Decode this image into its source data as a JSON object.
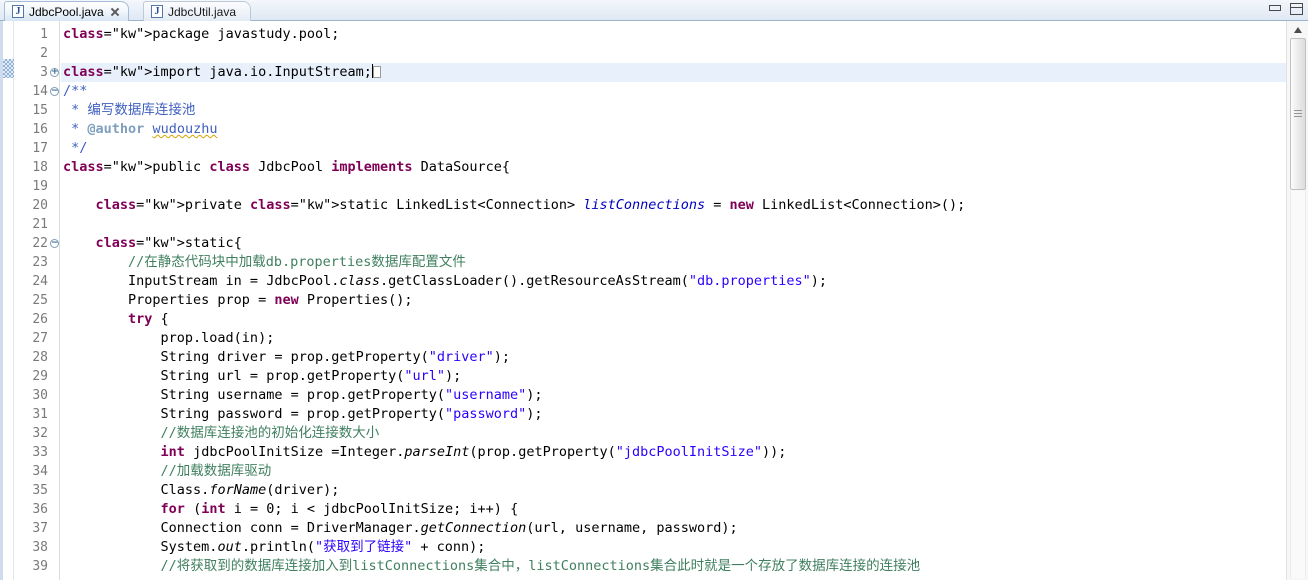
{
  "window": {
    "view_buttons": [
      {
        "name": "minimize",
        "icon": "minimize-icon",
        "tooltip": "Minimize"
      },
      {
        "name": "maximize",
        "icon": "maximize-icon",
        "tooltip": "Maximize"
      }
    ]
  },
  "tabs": [
    {
      "label": "JdbcPool.java",
      "icon": "java-file-icon",
      "active": true,
      "closable": true
    },
    {
      "label": "JdbcUtil.java",
      "icon": "java-file-icon",
      "active": false,
      "closable": false
    }
  ],
  "editor": {
    "language": "Java",
    "current_line": 3,
    "colors": {
      "keyword": "#7F0055",
      "string": "#2A00FF",
      "comment": "#3F7F5F",
      "javadoc": "#3F5FBF",
      "javadoc_tag": "#7F9FBF",
      "field": "#0000C0",
      "current_line_highlight": "#E8F1FB",
      "line_number": "#7A7A7A"
    },
    "fold_markers": [
      {
        "line": 3,
        "state": "collapsed",
        "glyph": "+"
      },
      {
        "line": 14,
        "state": "expanded",
        "glyph": "−"
      },
      {
        "line": 22,
        "state": "expanded",
        "glyph": "−"
      }
    ],
    "lines": [
      {
        "n": 1,
        "text": "package javastudy.pool;"
      },
      {
        "n": 2,
        "text": ""
      },
      {
        "n": 3,
        "text": "import java.io.InputStream;"
      },
      {
        "n": 14,
        "text": "/**"
      },
      {
        "n": 15,
        "text": " * 编写数据库连接池"
      },
      {
        "n": 16,
        "text": " * @author wudouzhu"
      },
      {
        "n": 17,
        "text": " */"
      },
      {
        "n": 18,
        "text": "public class JdbcPool implements DataSource{"
      },
      {
        "n": 19,
        "text": ""
      },
      {
        "n": 20,
        "text": "    private static LinkedList<Connection> listConnections = new LinkedList<Connection>();"
      },
      {
        "n": 21,
        "text": ""
      },
      {
        "n": 22,
        "text": "    static{"
      },
      {
        "n": 23,
        "text": "        //在静态代码块中加载db.properties数据库配置文件"
      },
      {
        "n": 24,
        "text": "        InputStream in = JdbcPool.class.getClassLoader().getResourceAsStream(\"db.properties\");"
      },
      {
        "n": 25,
        "text": "        Properties prop = new Properties();"
      },
      {
        "n": 26,
        "text": "        try {"
      },
      {
        "n": 27,
        "text": "            prop.load(in);"
      },
      {
        "n": 28,
        "text": "            String driver = prop.getProperty(\"driver\");"
      },
      {
        "n": 29,
        "text": "            String url = prop.getProperty(\"url\");"
      },
      {
        "n": 30,
        "text": "            String username = prop.getProperty(\"username\");"
      },
      {
        "n": 31,
        "text": "            String password = prop.getProperty(\"password\");"
      },
      {
        "n": 32,
        "text": "            //数据库连接池的初始化连接数大小"
      },
      {
        "n": 33,
        "text": "            int jdbcPoolInitSize =Integer.parseInt(prop.getProperty(\"jdbcPoolInitSize\"));"
      },
      {
        "n": 34,
        "text": "            //加载数据库驱动"
      },
      {
        "n": 35,
        "text": "            Class.forName(driver);"
      },
      {
        "n": 36,
        "text": "            for (int i = 0; i < jdbcPoolInitSize; i++) {"
      },
      {
        "n": 37,
        "text": "            Connection conn = DriverManager.getConnection(url, username, password);"
      },
      {
        "n": 38,
        "text": "            System.out.println(\"获取到了链接\" + conn);"
      },
      {
        "n": 39,
        "text": "            //将获取到的数据库连接加入到listConnections集合中，listConnections集合此时就是一个存放了数据库连接的连接池"
      }
    ]
  },
  "scrollbar": {
    "orientation": "vertical",
    "up_arrow_icon": "triangle-up-icon",
    "thumb_grip_icon": "grip-lines-icon"
  }
}
